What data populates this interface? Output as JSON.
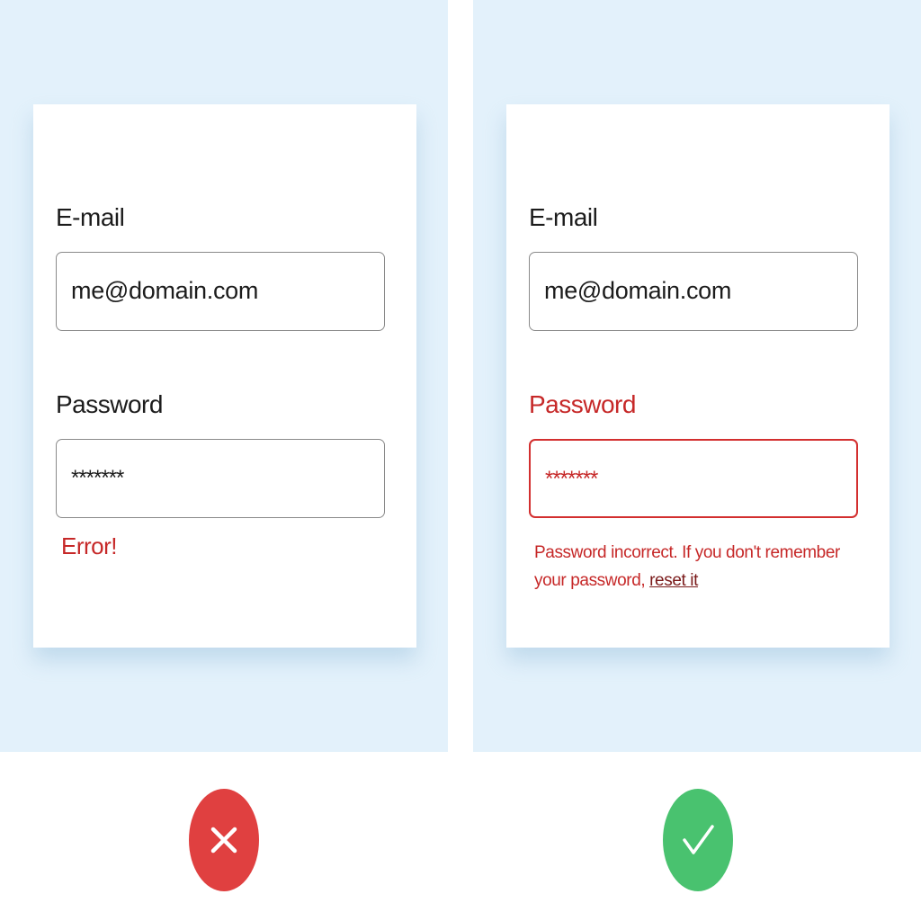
{
  "bad_example": {
    "email_label": "E-mail",
    "email_value": "me@domain.com",
    "password_label": "Password",
    "password_value": "*******",
    "error_message": "Error!",
    "badge_icon": "x-icon",
    "badge_color": "#e04040"
  },
  "good_example": {
    "email_label": "E-mail",
    "email_value": "me@domain.com",
    "password_label": "Password",
    "password_value": "*******",
    "error_message": "Password incorrect. If you don't remember your password, ",
    "reset_link": "reset it",
    "badge_icon": "check-icon",
    "badge_color": "#49c26f"
  },
  "colors": {
    "panel_background": "#e3f1fb",
    "error": "#c62828",
    "text": "#1c1c1c"
  }
}
